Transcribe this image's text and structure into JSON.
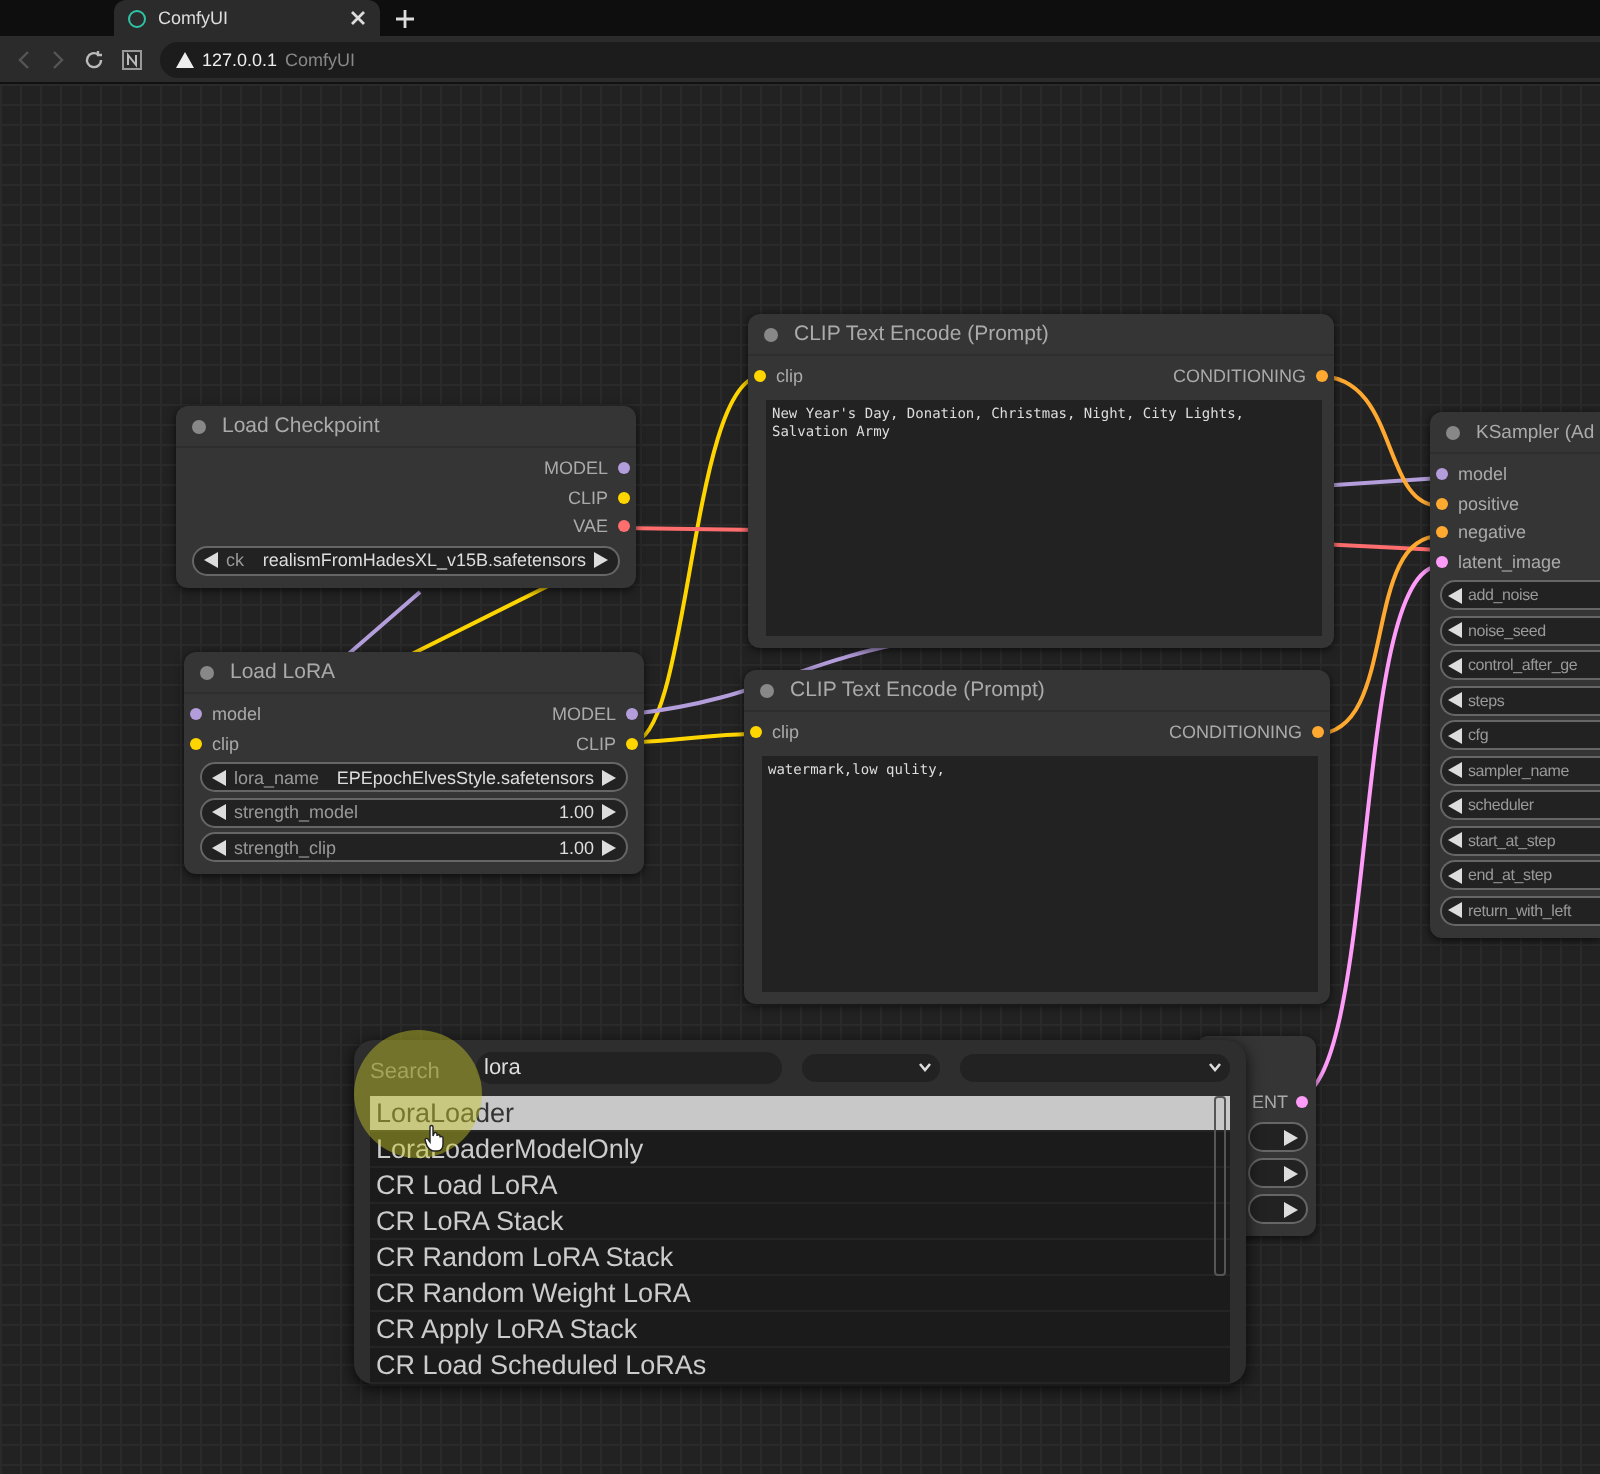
{
  "browser": {
    "tab": {
      "title": "ComfyUI"
    },
    "address": {
      "host": "127.0.0.1",
      "page_title": "ComfyUI"
    }
  },
  "nodes": [
    {
      "kind": "standard",
      "title": "Load Checkpoint",
      "outputs": [
        {
          "name": "MODEL",
          "color": "#b39ddb"
        },
        {
          "name": "CLIP",
          "color": "#ffd500"
        },
        {
          "name": "VAE",
          "color": "#ff6e6e"
        }
      ],
      "widgets": [
        {
          "label": "ck",
          "value": "realismFromHadesXL_v15B.safetensors"
        }
      ]
    },
    {
      "kind": "standard",
      "title": "Load LoRA",
      "inputs": [
        {
          "name": "model",
          "color": "#b39ddb"
        },
        {
          "name": "clip",
          "color": "#ffd500"
        }
      ],
      "outputs": [
        {
          "name": "MODEL",
          "color": "#b39ddb"
        },
        {
          "name": "CLIP",
          "color": "#ffd500"
        }
      ],
      "widgets": [
        {
          "label": "lora_name",
          "value": "EPEpochElvesStyle.safetensors"
        },
        {
          "label": "strength_model",
          "value": "1.00"
        },
        {
          "label": "strength_clip",
          "value": "1.00"
        }
      ]
    },
    {
      "kind": "prompt",
      "title": "CLIP Text Encode (Prompt)",
      "inputs": [
        {
          "name": "clip",
          "color": "#ffd500"
        }
      ],
      "outputs": [
        {
          "name": "CONDITIONING",
          "color": "#ffa931"
        }
      ],
      "text": "New Year's Day, Donation, Christmas, Night, City Lights, Salvation Army"
    },
    {
      "kind": "prompt",
      "title": "CLIP Text Encode (Prompt)",
      "inputs": [
        {
          "name": "clip",
          "color": "#ffd500"
        }
      ],
      "outputs": [
        {
          "name": "CONDITIONING",
          "color": "#ffa931"
        }
      ],
      "text": "watermark,low qulity,"
    },
    {
      "kind": "standard",
      "title": "KSampler (Ad",
      "inputs": [
        {
          "name": "model",
          "color": "#b39ddb"
        },
        {
          "name": "positive",
          "color": "#ffa931"
        },
        {
          "name": "negative",
          "color": "#ffa931"
        },
        {
          "name": "latent_image",
          "color": "#ff9cf9"
        }
      ],
      "widgets": [
        {
          "label": "add_noise"
        },
        {
          "label": "noise_seed"
        },
        {
          "label": "control_after_ge"
        },
        {
          "label": "steps"
        },
        {
          "label": "cfg"
        },
        {
          "label": "sampler_name"
        },
        {
          "label": "scheduler"
        },
        {
          "label": "start_at_step"
        },
        {
          "label": "end_at_step"
        },
        {
          "label": "return_with_left"
        }
      ]
    },
    {
      "kind": "partial",
      "outputs": [
        {
          "name": "ENT",
          "color": "#ff9cf9"
        }
      ]
    }
  ],
  "search": {
    "label": "Search",
    "value": "lora",
    "results": [
      {
        "name": "LoraLoader",
        "selected": true
      },
      {
        "name": "LoraLoaderModelOnly",
        "selected": false
      },
      {
        "name": "CR Load LoRA",
        "selected": false
      },
      {
        "name": "CR LoRA Stack",
        "selected": false
      },
      {
        "name": "CR Random LoRA Stack",
        "selected": false
      },
      {
        "name": "CR Random Weight LoRA",
        "selected": false
      },
      {
        "name": "CR Apply LoRA Stack",
        "selected": false
      },
      {
        "name": "CR Load Scheduled LoRAs",
        "selected": false
      }
    ]
  }
}
